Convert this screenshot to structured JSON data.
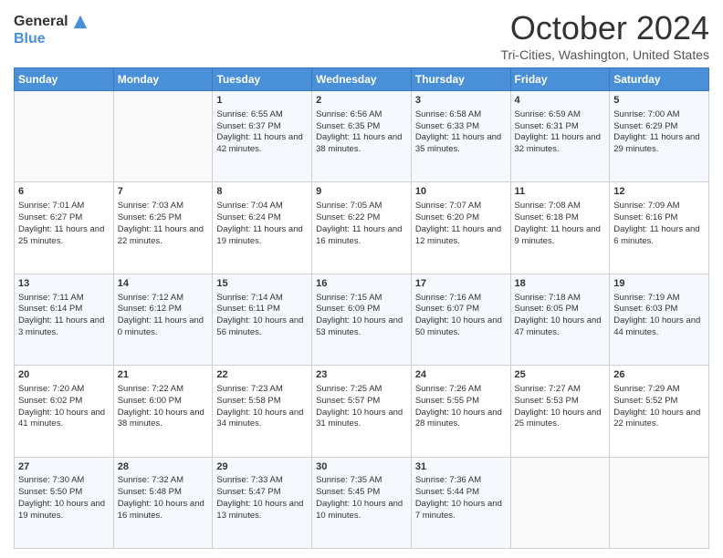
{
  "header": {
    "logo_line1": "General",
    "logo_line2": "Blue",
    "month": "October 2024",
    "location": "Tri-Cities, Washington, United States"
  },
  "days_of_week": [
    "Sunday",
    "Monday",
    "Tuesday",
    "Wednesday",
    "Thursday",
    "Friday",
    "Saturday"
  ],
  "weeks": [
    [
      {
        "day": "",
        "sunrise": "",
        "sunset": "",
        "daylight": ""
      },
      {
        "day": "",
        "sunrise": "",
        "sunset": "",
        "daylight": ""
      },
      {
        "day": "1",
        "sunrise": "Sunrise: 6:55 AM",
        "sunset": "Sunset: 6:37 PM",
        "daylight": "Daylight: 11 hours and 42 minutes."
      },
      {
        "day": "2",
        "sunrise": "Sunrise: 6:56 AM",
        "sunset": "Sunset: 6:35 PM",
        "daylight": "Daylight: 11 hours and 38 minutes."
      },
      {
        "day": "3",
        "sunrise": "Sunrise: 6:58 AM",
        "sunset": "Sunset: 6:33 PM",
        "daylight": "Daylight: 11 hours and 35 minutes."
      },
      {
        "day": "4",
        "sunrise": "Sunrise: 6:59 AM",
        "sunset": "Sunset: 6:31 PM",
        "daylight": "Daylight: 11 hours and 32 minutes."
      },
      {
        "day": "5",
        "sunrise": "Sunrise: 7:00 AM",
        "sunset": "Sunset: 6:29 PM",
        "daylight": "Daylight: 11 hours and 29 minutes."
      }
    ],
    [
      {
        "day": "6",
        "sunrise": "Sunrise: 7:01 AM",
        "sunset": "Sunset: 6:27 PM",
        "daylight": "Daylight: 11 hours and 25 minutes."
      },
      {
        "day": "7",
        "sunrise": "Sunrise: 7:03 AM",
        "sunset": "Sunset: 6:25 PM",
        "daylight": "Daylight: 11 hours and 22 minutes."
      },
      {
        "day": "8",
        "sunrise": "Sunrise: 7:04 AM",
        "sunset": "Sunset: 6:24 PM",
        "daylight": "Daylight: 11 hours and 19 minutes."
      },
      {
        "day": "9",
        "sunrise": "Sunrise: 7:05 AM",
        "sunset": "Sunset: 6:22 PM",
        "daylight": "Daylight: 11 hours and 16 minutes."
      },
      {
        "day": "10",
        "sunrise": "Sunrise: 7:07 AM",
        "sunset": "Sunset: 6:20 PM",
        "daylight": "Daylight: 11 hours and 12 minutes."
      },
      {
        "day": "11",
        "sunrise": "Sunrise: 7:08 AM",
        "sunset": "Sunset: 6:18 PM",
        "daylight": "Daylight: 11 hours and 9 minutes."
      },
      {
        "day": "12",
        "sunrise": "Sunrise: 7:09 AM",
        "sunset": "Sunset: 6:16 PM",
        "daylight": "Daylight: 11 hours and 6 minutes."
      }
    ],
    [
      {
        "day": "13",
        "sunrise": "Sunrise: 7:11 AM",
        "sunset": "Sunset: 6:14 PM",
        "daylight": "Daylight: 11 hours and 3 minutes."
      },
      {
        "day": "14",
        "sunrise": "Sunrise: 7:12 AM",
        "sunset": "Sunset: 6:12 PM",
        "daylight": "Daylight: 11 hours and 0 minutes."
      },
      {
        "day": "15",
        "sunrise": "Sunrise: 7:14 AM",
        "sunset": "Sunset: 6:11 PM",
        "daylight": "Daylight: 10 hours and 56 minutes."
      },
      {
        "day": "16",
        "sunrise": "Sunrise: 7:15 AM",
        "sunset": "Sunset: 6:09 PM",
        "daylight": "Daylight: 10 hours and 53 minutes."
      },
      {
        "day": "17",
        "sunrise": "Sunrise: 7:16 AM",
        "sunset": "Sunset: 6:07 PM",
        "daylight": "Daylight: 10 hours and 50 minutes."
      },
      {
        "day": "18",
        "sunrise": "Sunrise: 7:18 AM",
        "sunset": "Sunset: 6:05 PM",
        "daylight": "Daylight: 10 hours and 47 minutes."
      },
      {
        "day": "19",
        "sunrise": "Sunrise: 7:19 AM",
        "sunset": "Sunset: 6:03 PM",
        "daylight": "Daylight: 10 hours and 44 minutes."
      }
    ],
    [
      {
        "day": "20",
        "sunrise": "Sunrise: 7:20 AM",
        "sunset": "Sunset: 6:02 PM",
        "daylight": "Daylight: 10 hours and 41 minutes."
      },
      {
        "day": "21",
        "sunrise": "Sunrise: 7:22 AM",
        "sunset": "Sunset: 6:00 PM",
        "daylight": "Daylight: 10 hours and 38 minutes."
      },
      {
        "day": "22",
        "sunrise": "Sunrise: 7:23 AM",
        "sunset": "Sunset: 5:58 PM",
        "daylight": "Daylight: 10 hours and 34 minutes."
      },
      {
        "day": "23",
        "sunrise": "Sunrise: 7:25 AM",
        "sunset": "Sunset: 5:57 PM",
        "daylight": "Daylight: 10 hours and 31 minutes."
      },
      {
        "day": "24",
        "sunrise": "Sunrise: 7:26 AM",
        "sunset": "Sunset: 5:55 PM",
        "daylight": "Daylight: 10 hours and 28 minutes."
      },
      {
        "day": "25",
        "sunrise": "Sunrise: 7:27 AM",
        "sunset": "Sunset: 5:53 PM",
        "daylight": "Daylight: 10 hours and 25 minutes."
      },
      {
        "day": "26",
        "sunrise": "Sunrise: 7:29 AM",
        "sunset": "Sunset: 5:52 PM",
        "daylight": "Daylight: 10 hours and 22 minutes."
      }
    ],
    [
      {
        "day": "27",
        "sunrise": "Sunrise: 7:30 AM",
        "sunset": "Sunset: 5:50 PM",
        "daylight": "Daylight: 10 hours and 19 minutes."
      },
      {
        "day": "28",
        "sunrise": "Sunrise: 7:32 AM",
        "sunset": "Sunset: 5:48 PM",
        "daylight": "Daylight: 10 hours and 16 minutes."
      },
      {
        "day": "29",
        "sunrise": "Sunrise: 7:33 AM",
        "sunset": "Sunset: 5:47 PM",
        "daylight": "Daylight: 10 hours and 13 minutes."
      },
      {
        "day": "30",
        "sunrise": "Sunrise: 7:35 AM",
        "sunset": "Sunset: 5:45 PM",
        "daylight": "Daylight: 10 hours and 10 minutes."
      },
      {
        "day": "31",
        "sunrise": "Sunrise: 7:36 AM",
        "sunset": "Sunset: 5:44 PM",
        "daylight": "Daylight: 10 hours and 7 minutes."
      },
      {
        "day": "",
        "sunrise": "",
        "sunset": "",
        "daylight": ""
      },
      {
        "day": "",
        "sunrise": "",
        "sunset": "",
        "daylight": ""
      }
    ]
  ]
}
